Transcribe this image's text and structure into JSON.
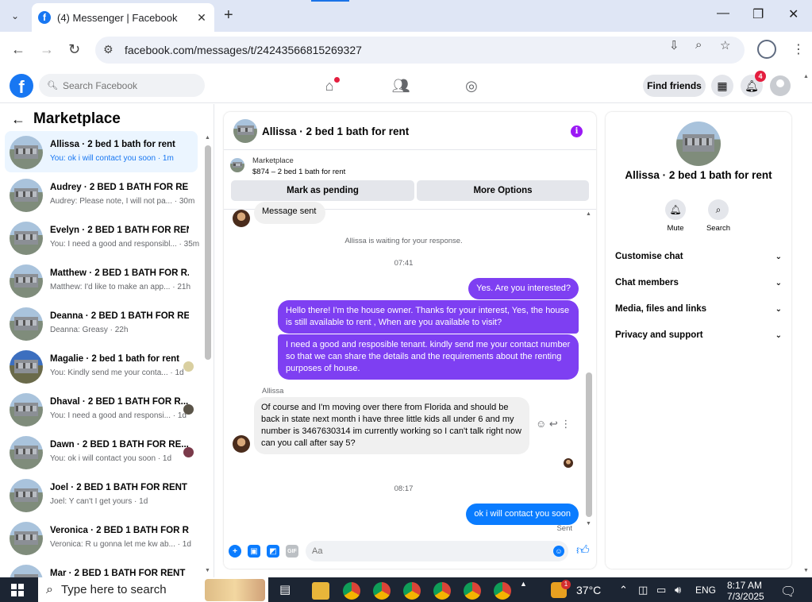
{
  "browser": {
    "tab_title": "(4) Messenger | Facebook",
    "url": "facebook.com/messages/t/24243566815269327"
  },
  "fb": {
    "logo": "f",
    "search_placeholder": "Search Facebook",
    "find_friends": "Find friends",
    "notif_count": "4"
  },
  "left": {
    "title": "Marketplace",
    "chats": [
      {
        "name": "Allissa · 2 bed 1 bath for rent",
        "preview": "You: ok i will contact you soon · 1m"
      },
      {
        "name": "Audrey · 2 BED 1 BATH FOR RENT",
        "preview": "Audrey: Please note, I will not pa... · 30m"
      },
      {
        "name": "Evelyn · 2 BED 1 BATH FOR RENT",
        "preview": "You: I need a good and responsibl... · 35m"
      },
      {
        "name": "Matthew · 2 BED 1 BATH FOR R...",
        "preview": "Matthew: I'd like to make an app... · 21h"
      },
      {
        "name": "Deanna · 2 BED 1 BATH FOR RE...",
        "preview": "Deanna: Greasy · 22h"
      },
      {
        "name": "Magalie · 2 bed 1 bath for rent",
        "preview": "You: Kindly send me your conta... · 1d"
      },
      {
        "name": "Dhaval · 2 BED 1 BATH FOR R...",
        "preview": "You: I need a good and responsi... · 1d"
      },
      {
        "name": "Dawn · 2 BED 1 BATH FOR RE...",
        "preview": "You: ok i will contact you soon · 1d"
      },
      {
        "name": "Joel · 2 BED 1 BATH FOR RENT",
        "preview": "Joel: Y can't I get yours · 1d"
      },
      {
        "name": "Veronica · 2 BED 1 BATH FOR RE...",
        "preview": "Veronica: R u gonna let me kw ab... · 1d"
      },
      {
        "name": "Mar · 2 BED 1 BATH FOR RENT",
        "preview": ""
      }
    ]
  },
  "chat": {
    "title": "Allissa · 2 bed 1 bath for rent",
    "marketplace_label": "Marketplace",
    "listing": "$874 – 2 bed 1 bath for rent",
    "btn_pending": "Mark as pending",
    "btn_more": "More Options",
    "partial_msg": "Message sent",
    "waiting": "Allissa is waiting for your response.",
    "time1": "07:41",
    "out1": "Yes. Are you interested?",
    "out2": "Hello there! I'm the house owner. Thanks for your interest, Yes, the house is still available to rent , When are you available to visit?",
    "out3": "I need a good and resposible tenant.  kindly send me your contact number so that we can share the details and the requirements about the renting purposes of house.",
    "sender": "Allissa",
    "in1": "Of course and I'm moving over there from Florida and should be back in state next month i have three little kids all under 6 and my number is 3467630314 im currently working so I can't talk right now can you call after say 5?",
    "time2": "08:17",
    "out4": "ok i will contact you soon",
    "sent": "Sent",
    "composer_placeholder": "Aa"
  },
  "right": {
    "name": "Allissa · 2 bed 1 bath for rent",
    "mute": "Mute",
    "search": "Search",
    "rows": [
      "Customise chat",
      "Chat members",
      "Media, files and links",
      "Privacy and support"
    ]
  },
  "taskbar": {
    "search": "Type here to search",
    "weather_badge": "1",
    "temp": "37°C",
    "lang": "ENG",
    "time": "8:17 AM",
    "date": "7/3/2025"
  },
  "colors": {
    "fb_blue": "#1877f2",
    "bubble_purple": "#7e3ff2",
    "bubble_blue": "#0a7cff",
    "badge_red": "#e41e3f"
  }
}
